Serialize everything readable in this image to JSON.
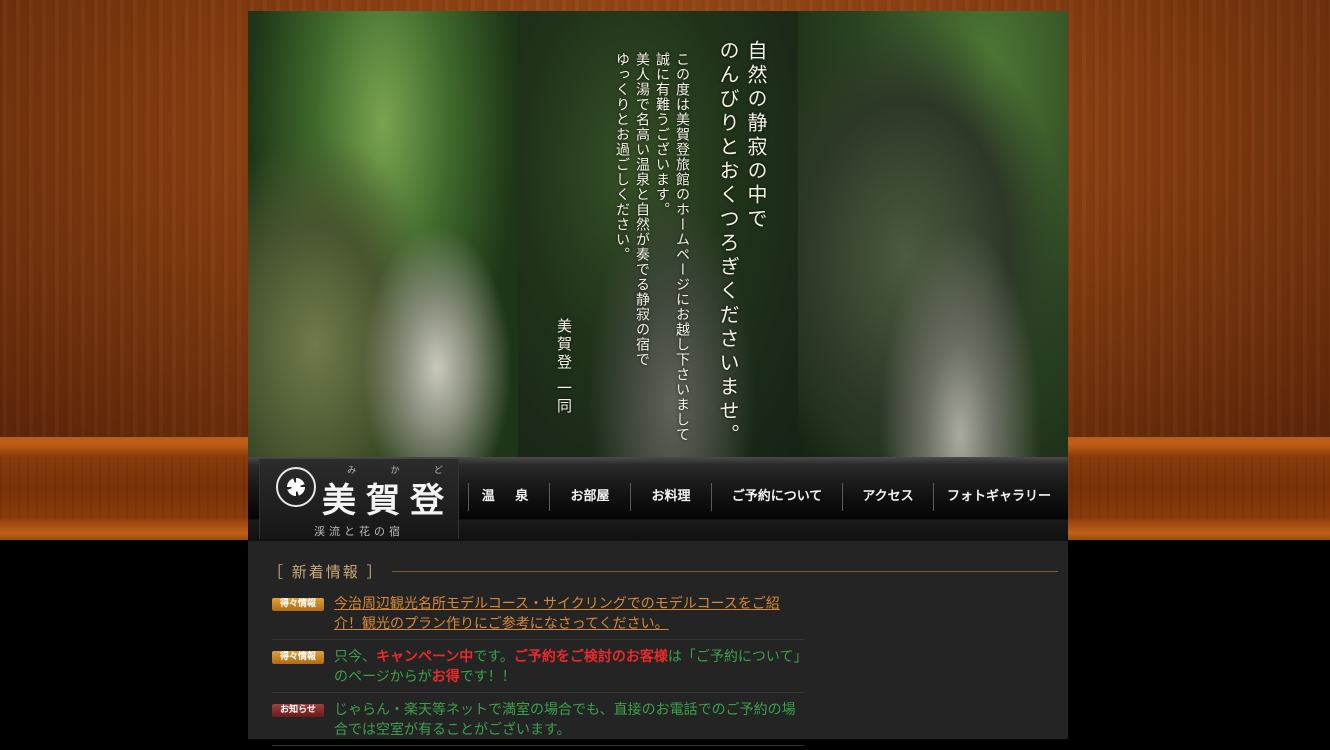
{
  "hero": {
    "main_lines": [
      "のんびりとおくつろぎくださいませ。",
      "自然の静寂の中で"
    ],
    "message_lines": [
      "この度は美賀登旅館のホームページにお越し下さいまして",
      "誠に有難うございます。",
      "美人湯で名高い温泉と自然が奏でる静寂の宿で",
      "ゆっくりとお過ごしください。"
    ],
    "signature": "美賀登 一同"
  },
  "logo": {
    "ruby": [
      "み",
      "か",
      "ど"
    ],
    "title": "美賀登",
    "subtitle": "渓流と花の宿",
    "crest_icon": "family-crest-icon"
  },
  "nav": {
    "items": [
      "温 泉",
      "お部屋",
      "お料理",
      "ご予約について",
      "アクセス",
      "フォトギャラリー"
    ]
  },
  "news": {
    "heading": "［ 新着情報 ］",
    "items": [
      {
        "tag": "得々情報",
        "link_text": "今治周辺観光名所モデルコース・サイクリングでのモデルコースをご紹介！観光のプラン作りにご参考になさってください。"
      },
      {
        "tag": "得々情報",
        "parts": [
          "只今、",
          "キャンペーン中",
          "です。",
          "ご予約をご検討のお客様",
          "は「ご予約について」のページからが",
          "お得",
          "です！！"
        ]
      },
      {
        "tag": "お知らせ",
        "text": "じゃらん・楽天等ネットで満室の場合でも、直接のお電話でのご予約の場合では空室が有ることがございます。"
      }
    ]
  },
  "colors": {
    "wood": "#8a3f12",
    "link_orange": "#d6883a",
    "green_text": "#3aa04a",
    "highlight_red": "#e82a2a",
    "heading_gold": "#c8a878"
  }
}
